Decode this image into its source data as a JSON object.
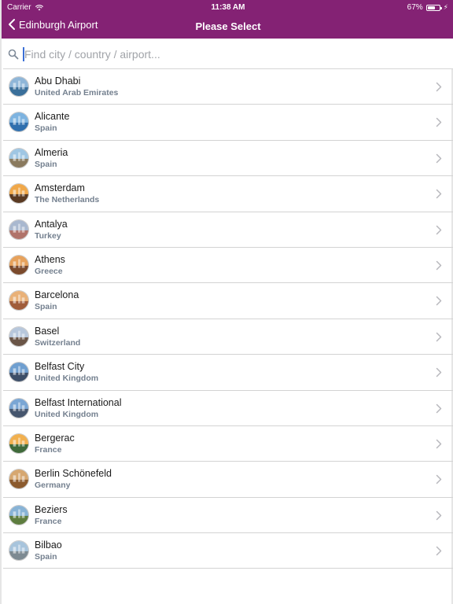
{
  "status_bar": {
    "carrier": "Carrier",
    "time": "11:38 AM",
    "battery": "67%",
    "battery_level": 0.67,
    "icons": [
      "wifi-icon",
      "battery-icon",
      "charging-icon"
    ]
  },
  "navbar": {
    "back_label": "Edinburgh Airport",
    "title": "Please Select",
    "background": "#842274"
  },
  "search": {
    "placeholder": "Find city / country / airport..."
  },
  "destinations": [
    {
      "city": "Abu Dhabi",
      "country": "United Arab Emirates",
      "sky": "#8fb6d8",
      "ground": "#3a6f9a"
    },
    {
      "city": "Alicante",
      "country": "Spain",
      "sky": "#7db3e0",
      "ground": "#2f6fae"
    },
    {
      "city": "Almeria",
      "country": "Spain",
      "sky": "#9fc6e3",
      "ground": "#8a7a5e"
    },
    {
      "city": "Amsterdam",
      "country": "The Netherlands",
      "sky": "#f0a84a",
      "ground": "#5a3a22"
    },
    {
      "city": "Antalya",
      "country": "Turkey",
      "sky": "#a9b8cf",
      "ground": "#b0736a"
    },
    {
      "city": "Athens",
      "country": "Greece",
      "sky": "#e7a25c",
      "ground": "#7b4a2c"
    },
    {
      "city": "Barcelona",
      "country": "Spain",
      "sky": "#e9b178",
      "ground": "#a05c3a"
    },
    {
      "city": "Basel",
      "country": "Switzerland",
      "sky": "#b7c7dc",
      "ground": "#6a5547"
    },
    {
      "city": "Belfast City",
      "country": "United Kingdom",
      "sky": "#6f9fd0",
      "ground": "#3c4e68"
    },
    {
      "city": "Belfast International",
      "country": "United Kingdom",
      "sky": "#7aa6d4",
      "ground": "#46566e"
    },
    {
      "city": "Bergerac",
      "country": "France",
      "sky": "#f1b04f",
      "ground": "#3f6a3a"
    },
    {
      "city": "Berlin Schönefeld",
      "country": "Germany",
      "sky": "#d6a770",
      "ground": "#8b5a2e"
    },
    {
      "city": "Beziers",
      "country": "France",
      "sky": "#88b3d6",
      "ground": "#5e7d3f"
    },
    {
      "city": "Bilbao",
      "country": "Spain",
      "sky": "#a8c4dc",
      "ground": "#7d8a92"
    }
  ]
}
